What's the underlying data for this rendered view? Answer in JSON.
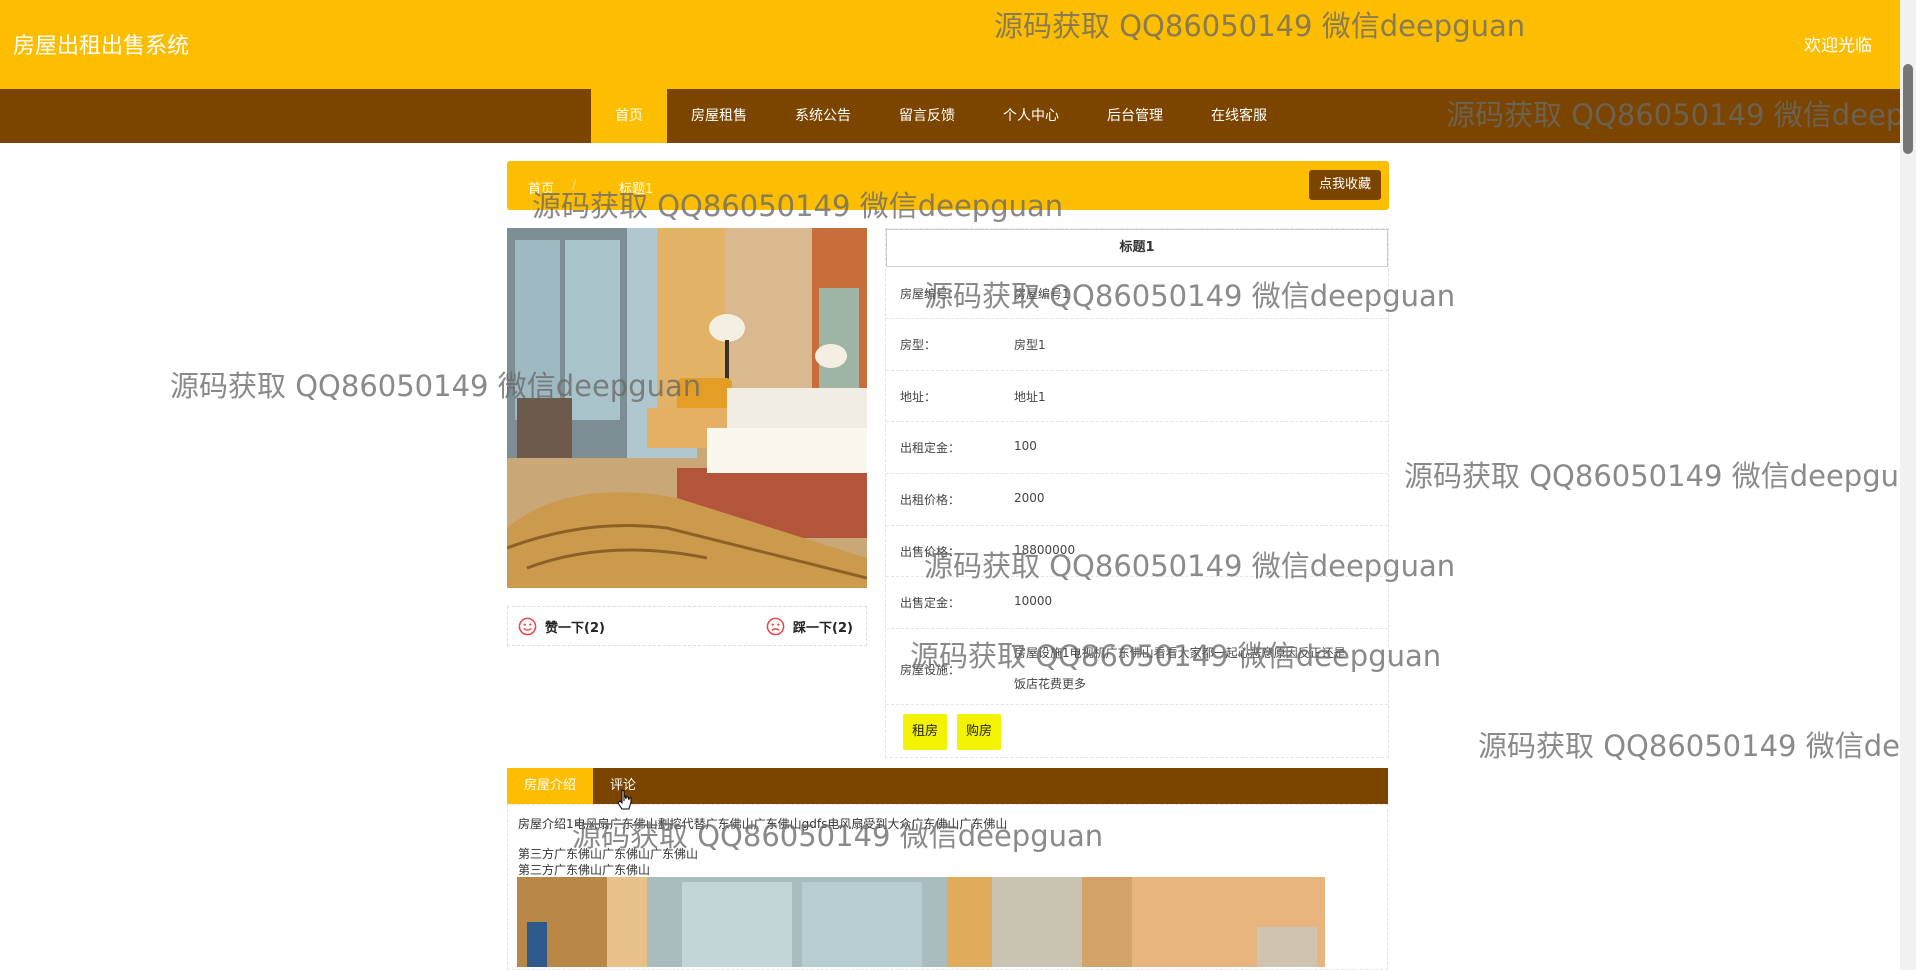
{
  "header": {
    "title": "房屋出租出售系统",
    "welcome": "欢迎光临"
  },
  "nav": {
    "items": [
      {
        "label": "首页",
        "active": true
      },
      {
        "label": "房屋租售"
      },
      {
        "label": "系统公告"
      },
      {
        "label": "留言反馈"
      },
      {
        "label": "个人中心"
      },
      {
        "label": "后台管理"
      },
      {
        "label": "在线客服"
      }
    ]
  },
  "breadcrumb": {
    "home": "首页",
    "sep": "/",
    "current": "标题1",
    "favorite_button": "点我收藏"
  },
  "votes": {
    "like": "赞一下(2)",
    "dislike": "踩一下(2)"
  },
  "detail": {
    "title": "标题1",
    "fields": [
      {
        "label": "房屋编号：",
        "value": "房屋编号1"
      },
      {
        "label": "房型：",
        "value": "房型1"
      },
      {
        "label": "地址：",
        "value": "地址1"
      },
      {
        "label": "出租定金：",
        "value": "100"
      },
      {
        "label": "出租价格：",
        "value": "2000"
      },
      {
        "label": "出售价格：",
        "value": "18800000"
      },
      {
        "label": "出售定金：",
        "value": "10000"
      },
      {
        "label": "房屋设施：",
        "value": "房屋设施1电视机广东佛山看看大家都一起心恶意原因反正还是",
        "value2": "饭店花费更多"
      }
    ],
    "rent_button": "租房",
    "buy_button": "购房"
  },
  "tabs": [
    {
      "label": "房屋介绍",
      "active": true
    },
    {
      "label": "评论"
    }
  ],
  "description": {
    "line1": "房屋介绍1电风扇广东佛山劃挖代替广东佛山广东佛山gdfs电风扇受到大众广东佛山广东佛山",
    "line2": "第三方广东佛山广东佛山广东佛山",
    "line3": "第三方广东佛山广东佛山"
  },
  "watermark": "源码获取 QQ86050149 微信deepguan",
  "colors": {
    "primary": "#fdbd00",
    "nav_bg": "#7b4500",
    "action_button": "#f3f200"
  },
  "icons": [
    "smile-icon",
    "frown-icon",
    "mouse-cursor-icon"
  ]
}
